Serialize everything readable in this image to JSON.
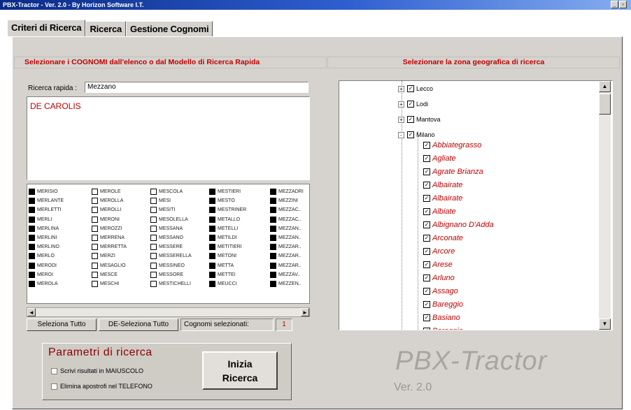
{
  "window": {
    "title": "PBX-Tractor - Ver. 2.0 - By Horizon Software I.T.",
    "controls": [
      "_",
      "▫"
    ]
  },
  "tabs": [
    {
      "label": "Criteri di Ricerca",
      "active": true
    },
    {
      "label": "Ricerca",
      "active": false
    },
    {
      "label": "Gestione Cognomi",
      "active": false
    }
  ],
  "left": {
    "header": "Selezionare i COGNOMI dall'elenco o dal Modello di Ricerca Rapida",
    "quick_label": "Ricerca rapida :",
    "quick_value": "Mezzano",
    "selected_name": "DE CAROLIS",
    "surname_columns": [
      [
        {
          "name": "MERISIO",
          "checked": true
        },
        {
          "name": "MERLANTE",
          "checked": true
        },
        {
          "name": "MERLETTI",
          "checked": true
        },
        {
          "name": "MERLI",
          "checked": true
        },
        {
          "name": "MERLINA",
          "checked": true
        },
        {
          "name": "MERLINI",
          "checked": true
        },
        {
          "name": "MERLINO",
          "checked": true
        },
        {
          "name": "MERLO",
          "checked": true
        },
        {
          "name": "MERODI",
          "checked": true
        },
        {
          "name": "MEROI",
          "checked": true
        },
        {
          "name": "MEROLA",
          "checked": true
        }
      ],
      [
        {
          "name": "MEROLE",
          "checked": false
        },
        {
          "name": "MEROLLA",
          "checked": false
        },
        {
          "name": "MEROLLI",
          "checked": false
        },
        {
          "name": "MERONI",
          "checked": false
        },
        {
          "name": "MEROZZI",
          "checked": false
        },
        {
          "name": "MERRENA",
          "checked": false
        },
        {
          "name": "MERRETTA",
          "checked": false
        },
        {
          "name": "MERZI",
          "checked": false
        },
        {
          "name": "MESAGLIO",
          "checked": false
        },
        {
          "name": "MESCE",
          "checked": false
        },
        {
          "name": "MESCHI",
          "checked": false
        }
      ],
      [
        {
          "name": "MESCOLA",
          "checked": false
        },
        {
          "name": "MESI",
          "checked": false
        },
        {
          "name": "MESITI",
          "checked": false
        },
        {
          "name": "MESOLELLA",
          "checked": false
        },
        {
          "name": "MESSANA",
          "checked": false
        },
        {
          "name": "MESSANO",
          "checked": false
        },
        {
          "name": "MESSERE",
          "checked": false
        },
        {
          "name": "MESSERELLA",
          "checked": false
        },
        {
          "name": "MESSINEO",
          "checked": false
        },
        {
          "name": "MESSORE",
          "checked": false
        },
        {
          "name": "MESTICHELLI",
          "checked": false
        }
      ],
      [
        {
          "name": "MESTIERI",
          "checked": true
        },
        {
          "name": "MESTO",
          "checked": true
        },
        {
          "name": "MESTRINER",
          "checked": true
        },
        {
          "name": "METALLO",
          "checked": true
        },
        {
          "name": "METELLI",
          "checked": true
        },
        {
          "name": "METILDI",
          "checked": true
        },
        {
          "name": "METITIERI",
          "checked": true
        },
        {
          "name": "METONI",
          "checked": true
        },
        {
          "name": "METTA",
          "checked": true
        },
        {
          "name": "METTEI",
          "checked": true
        },
        {
          "name": "MEUCCI",
          "checked": true
        }
      ],
      [
        {
          "name": "MEZZADRI",
          "checked": true
        },
        {
          "name": "MEZZINI",
          "checked": true
        },
        {
          "name": "MEZZAC..",
          "checked": true
        },
        {
          "name": "MEZZAC..",
          "checked": true
        },
        {
          "name": "MEZZAN..",
          "checked": true
        },
        {
          "name": "MEZZAN..",
          "checked": true
        },
        {
          "name": "MEZZAR..",
          "checked": true
        },
        {
          "name": "MEZZAR..",
          "checked": true
        },
        {
          "name": "MEZZAR..",
          "checked": true
        },
        {
          "name": "MEZZAV..",
          "checked": true
        },
        {
          "name": "MEZZEN..",
          "checked": true
        }
      ]
    ],
    "select_all": "Seleziona Tutto",
    "deselect_all": "DE-Seleziona Tutto",
    "selected_count_label": "Cognomi selezionati:",
    "selected_count": "1"
  },
  "params": {
    "title": "Parametri di ricerca",
    "opt_uppercase": "Scrivi risultati in MAIUSCOLO",
    "opt_phone": "Elimina apostrofi nel TELEFONO",
    "start_line1": "Inizia",
    "start_line2": "Ricerca"
  },
  "right": {
    "header": "Selezionare la zona geografica di ricerca",
    "provinces": [
      {
        "name": "Lecco",
        "expander": "+"
      },
      {
        "name": "Lodi",
        "expander": "+"
      },
      {
        "name": "Mantova",
        "expander": "+"
      },
      {
        "name": "Milano",
        "expander": "-"
      }
    ],
    "municipalities": [
      "Abbiategrasso",
      "Agliate",
      "Agrate Brianza",
      "Albairate",
      "Albairate",
      "Albiate",
      "Albignano D'Adda",
      "Arconate",
      "Arcore",
      "Arese",
      "Arluno",
      "Assago",
      "Bareggio",
      "Basiano",
      "Bareggio"
    ],
    "logo": "PBX-Tractor",
    "version": "Ver. 2.0"
  }
}
